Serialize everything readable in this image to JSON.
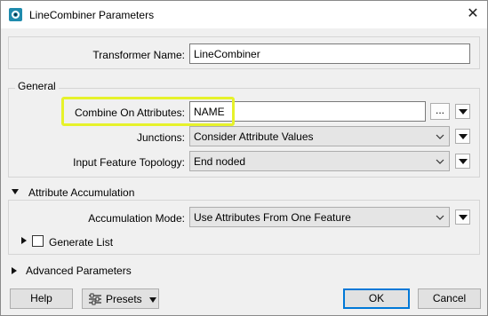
{
  "window": {
    "title": "LineCombiner Parameters"
  },
  "transformer_name": {
    "label": "Transformer Name:",
    "value": "LineCombiner"
  },
  "general": {
    "heading": "General",
    "combine_on_attributes": {
      "label": "Combine On Attributes:",
      "value": "NAME",
      "browse_label": "..."
    },
    "junctions": {
      "label": "Junctions:",
      "value": "Consider Attribute Values"
    },
    "input_feature_topology": {
      "label": "Input Feature Topology:",
      "value": "End noded"
    }
  },
  "attribute_accumulation": {
    "heading": "Attribute Accumulation",
    "accumulation_mode": {
      "label": "Accumulation Mode:",
      "value": "Use Attributes From One Feature"
    },
    "generate_list": {
      "label": "Generate List",
      "checked": false
    }
  },
  "advanced_parameters": {
    "heading": "Advanced Parameters"
  },
  "buttons": {
    "help": "Help",
    "presets": "Presets",
    "ok": "OK",
    "cancel": "Cancel"
  },
  "colors": {
    "highlight": "#e6f22a",
    "ok_border": "#0078d7",
    "app_icon": "#1f8bad"
  }
}
